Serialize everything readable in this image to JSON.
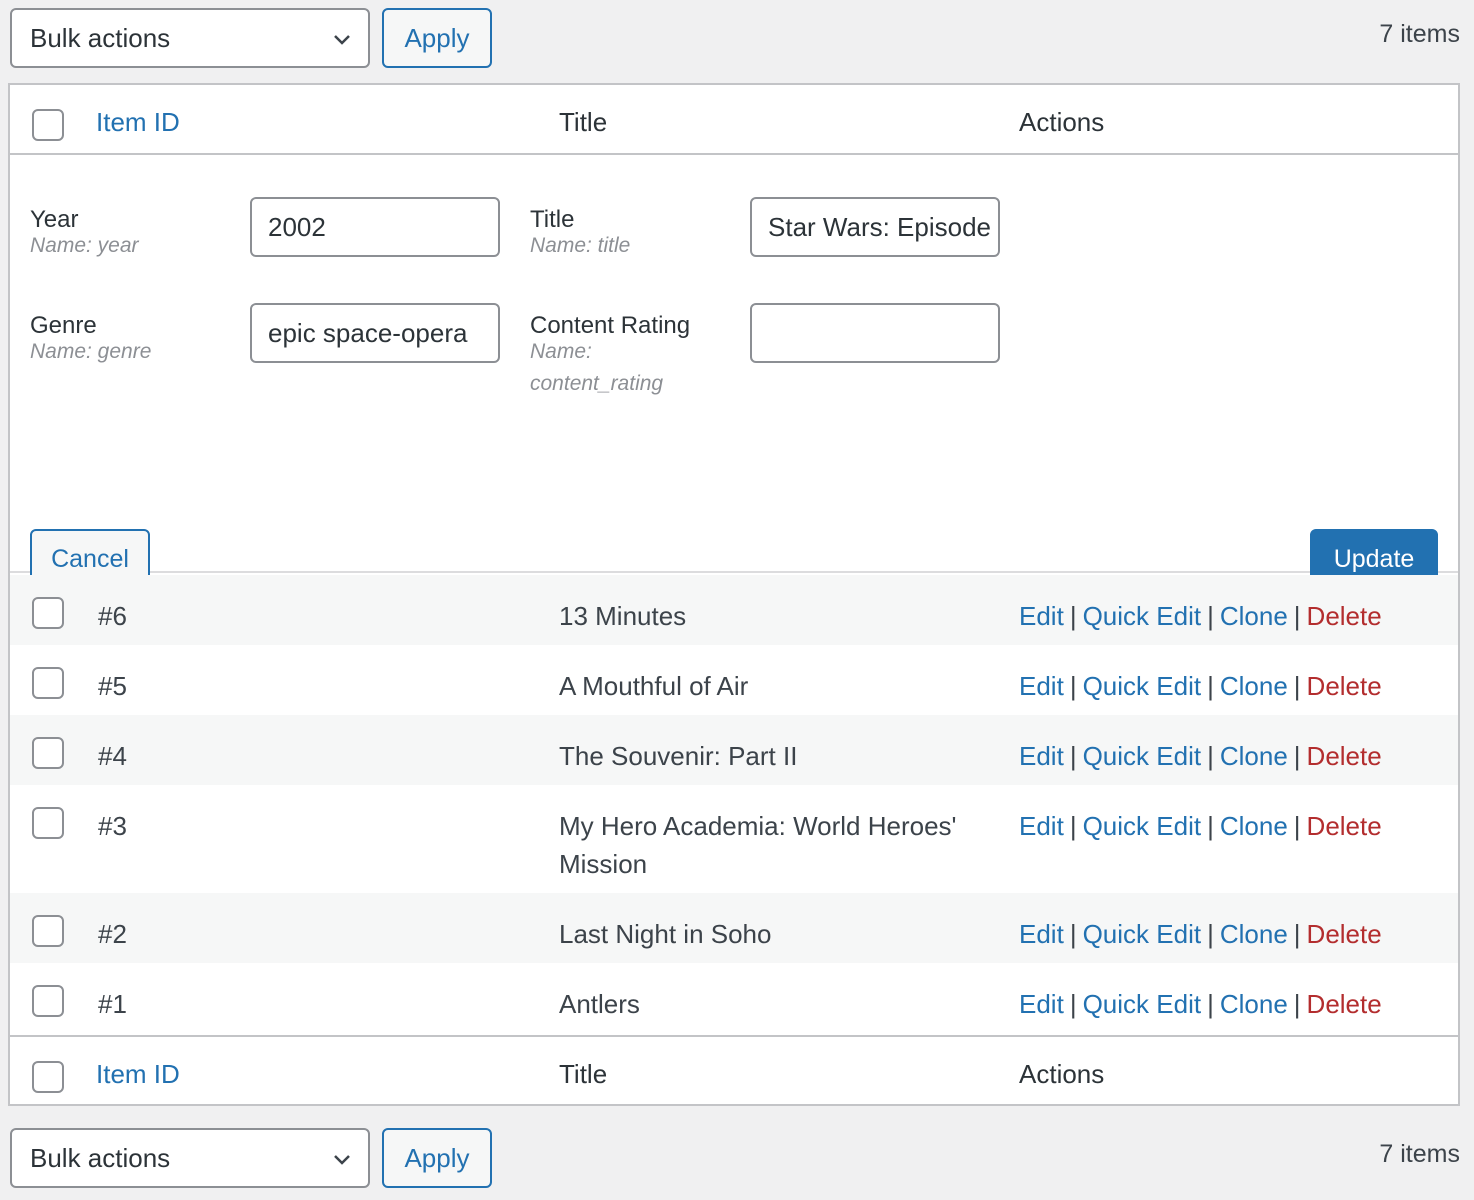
{
  "tablenav_top": {
    "bulk_actions": "Bulk actions",
    "apply": "Apply",
    "count": "7 items"
  },
  "tablenav_bottom": {
    "bulk_actions": "Bulk actions",
    "apply": "Apply",
    "count": "7 items"
  },
  "columns": {
    "id": "Item ID",
    "title": "Title",
    "actions": "Actions"
  },
  "quick_edit": {
    "year": {
      "label": "Year",
      "name": "Name: year",
      "value": "2002"
    },
    "title": {
      "label": "Title",
      "name": "Name: title",
      "value": "Star Wars: Episode II"
    },
    "genre": {
      "label": "Genre",
      "name": "Name: genre",
      "value": "epic space-opera"
    },
    "content_rating": {
      "label": "Content Rating",
      "name_line1": "Name:",
      "name_line2": "content_rating",
      "value": ""
    },
    "cancel": "Cancel",
    "update": "Update"
  },
  "row_actions": {
    "edit": "Edit",
    "quick_edit": "Quick Edit",
    "clone": "Clone",
    "delete": "Delete",
    "separator": "|"
  },
  "rows": [
    {
      "id": "#6",
      "title": "13 Minutes"
    },
    {
      "id": "#5",
      "title": "A Mouthful of Air"
    },
    {
      "id": "#4",
      "title": "The Souvenir: Part II"
    },
    {
      "id": "#3",
      "title": "My Hero Academia: World Heroes' Mission"
    },
    {
      "id": "#2",
      "title": "Last Night in Soho"
    },
    {
      "id": "#1",
      "title": "Antlers"
    }
  ],
  "colors": {
    "link": "#2271b1",
    "delete": "#b32d2e",
    "primary_button": "#2271b1"
  },
  "icons": {
    "select_arrow": "chevron-down-icon"
  }
}
